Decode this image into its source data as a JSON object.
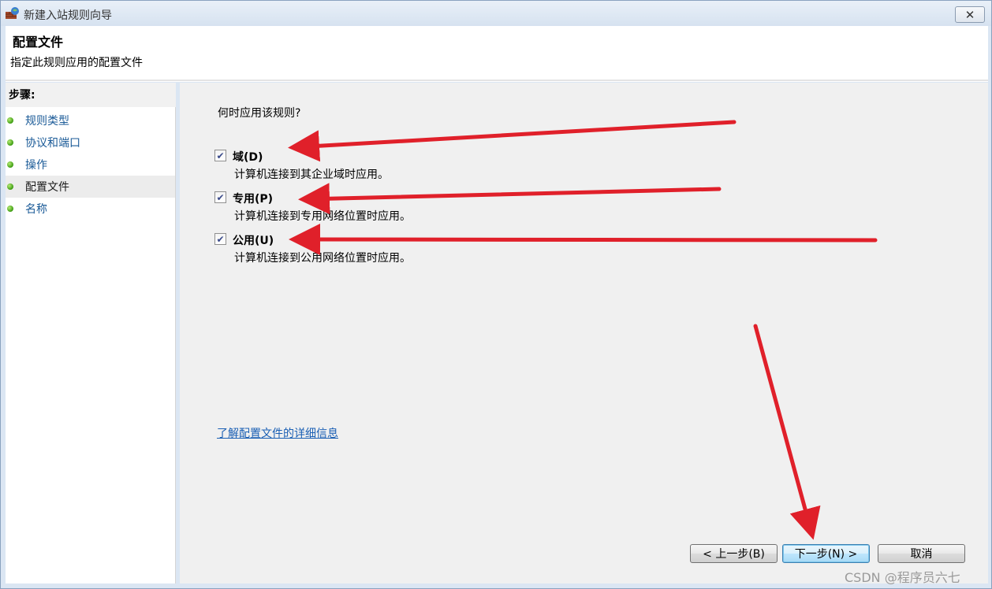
{
  "window": {
    "title": "新建入站规则向导",
    "close_label": "✕"
  },
  "header": {
    "title": "配置文件",
    "subtitle": "指定此规则应用的配置文件"
  },
  "sidebar": {
    "heading": "步骤:",
    "items": [
      {
        "label": "规则类型"
      },
      {
        "label": "协议和端口"
      },
      {
        "label": "操作"
      },
      {
        "label": "配置文件"
      },
      {
        "label": "名称"
      }
    ]
  },
  "main": {
    "question": "何时应用该规则?",
    "options": [
      {
        "label": "域(D)",
        "description": "计算机连接到其企业域时应用。",
        "checked": true
      },
      {
        "label": "专用(P)",
        "description": "计算机连接到专用网络位置时应用。",
        "checked": true
      },
      {
        "label": "公用(U)",
        "description": "计算机连接到公用网络位置时应用。",
        "checked": true
      }
    ],
    "info_link": "了解配置文件的详细信息"
  },
  "buttons": {
    "back": "< 上一步(B)",
    "next": "下一步(N) >",
    "cancel": "取消"
  },
  "watermark": "CSDN @程序员六七",
  "colors": {
    "annotation_arrow": "#e0202a",
    "link": "#1a5fb4",
    "step_link": "#1a5a97"
  }
}
